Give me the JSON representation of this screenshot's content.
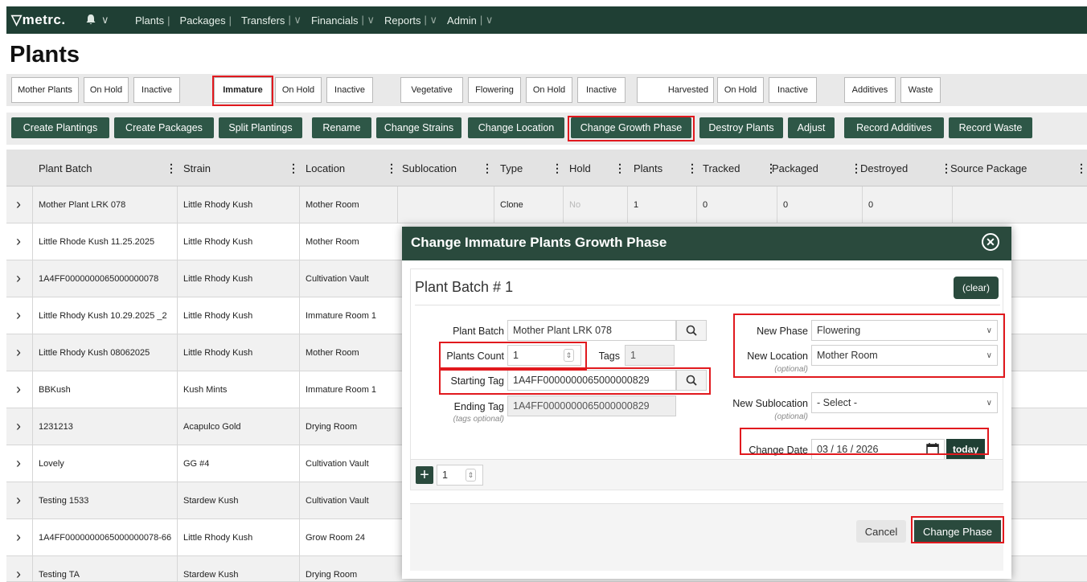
{
  "nav": {
    "logo": "▽metrc.",
    "bell_caret": "∨",
    "items": [
      {
        "label": "Plants",
        "sep": "|"
      },
      {
        "label": "Packages",
        "sep": "|"
      },
      {
        "label": "Transfers",
        "sep": "| ∨"
      },
      {
        "label": "Financials",
        "sep": "| ∨"
      },
      {
        "label": "Reports",
        "sep": "| ∨"
      },
      {
        "label": "Admin",
        "sep": "| ∨"
      }
    ]
  },
  "page": {
    "title": "Plants"
  },
  "tabs": [
    "Mother Plants",
    "On Hold",
    "Inactive",
    "Immature",
    "On Hold",
    "Inactive",
    "Vegetative",
    "Flowering",
    "On Hold",
    "Inactive",
    "Harvested",
    "On Hold",
    "Inactive",
    "Additives",
    "Waste"
  ],
  "active_tab": "Immature",
  "actions": [
    "Create Plantings",
    "Create Packages",
    "Split Plantings",
    "Rename",
    "Change Strains",
    "Change Location",
    "Change Growth Phase",
    "Destroy Plants",
    "Adjust",
    "Record Additives",
    "Record Waste"
  ],
  "columns": [
    "Plant Batch",
    "Strain",
    "Location",
    "Sublocation",
    "Type",
    "Hold",
    "Plants",
    "Tracked",
    "Packaged",
    "Destroyed",
    "Source Package"
  ],
  "rows": [
    {
      "batch": "Mother Plant LRK 078",
      "strain": "Little Rhody Kush",
      "location": "Mother Room",
      "type": "Clone",
      "hold": "No",
      "plants": "1",
      "tracked": "0",
      "packaged": "0",
      "destroyed": "0"
    },
    {
      "batch": "Little Rhode Kush 11.25.2025",
      "strain": "Little Rhody Kush",
      "location": "Mother Room"
    },
    {
      "batch": "1A4FF0000000065000000078",
      "strain": "Little Rhody Kush",
      "location": "Cultivation Vault"
    },
    {
      "batch": "Little Rhody Kush 10.29.2025 _2",
      "strain": "Little Rhody Kush",
      "location": "Immature Room 1"
    },
    {
      "batch": "Little Rhody Kush 08062025",
      "strain": "Little Rhody Kush",
      "location": "Mother Room"
    },
    {
      "batch": "BBKush",
      "strain": "Kush Mints",
      "location": "Immature Room 1"
    },
    {
      "batch": "1231213",
      "strain": "Acapulco Gold",
      "location": "Drying Room"
    },
    {
      "batch": "Lovely",
      "strain": "GG #4",
      "location": "Cultivation Vault"
    },
    {
      "batch": "Testing 1533",
      "strain": "Stardew Kush",
      "location": "Cultivation Vault"
    },
    {
      "batch": "1A4FF0000000065000000078-66",
      "strain": "Little Rhody Kush",
      "location": "Grow Room 24"
    },
    {
      "batch": "Testing TA",
      "strain": "Stardew Kush",
      "location": "Drying Room"
    }
  ],
  "modal": {
    "title": "Change Immature Plants Growth Phase",
    "batch_heading": "Plant Batch # 1",
    "clear_label": "(clear)",
    "plant_batch_label": "Plant Batch",
    "plant_batch_value": "Mother Plant LRK 078",
    "plants_count_label": "Plants Count",
    "plants_count_value": "1",
    "tags_label": "Tags",
    "tags_value": "1",
    "starting_tag_label": "Starting Tag",
    "starting_tag_value": "1A4FF0000000065000000829",
    "ending_tag_label": "Ending Tag",
    "ending_tag_value": "1A4FF0000000065000000829",
    "tags_optional": "(tags optional)",
    "new_phase_label": "New Phase",
    "new_phase_value": "Flowering",
    "new_location_label": "New Location",
    "new_location_value": "Mother Room",
    "optional": "(optional)",
    "new_sublocation_label": "New Sublocation",
    "new_sublocation_value": "- Select -",
    "change_date_label": "Change Date",
    "change_date_value": "03 / 16 / 2026",
    "today_label": "today",
    "add_count": "1",
    "cancel_label": "Cancel",
    "submit_label": "Change Phase"
  },
  "colors": {
    "nav_bg": "#1f3f34",
    "button_bg": "#2e5747",
    "highlight": "#e1191e"
  }
}
